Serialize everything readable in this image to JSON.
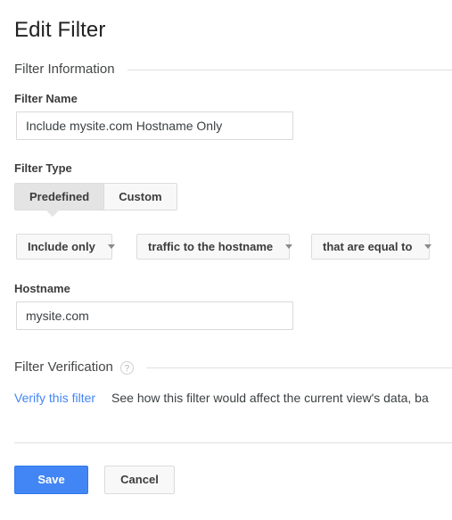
{
  "page": {
    "title": "Edit Filter"
  },
  "sections": {
    "filter_information": {
      "label": "Filter Information"
    },
    "filter_verification": {
      "label": "Filter Verification",
      "help_icon": "help-circle-icon",
      "help_glyph": "?"
    }
  },
  "fields": {
    "filter_name": {
      "label": "Filter Name",
      "value": "Include mysite.com Hostname Only",
      "placeholder": ""
    },
    "filter_type": {
      "label": "Filter Type",
      "tabs": [
        {
          "label": "Predefined",
          "selected": true
        },
        {
          "label": "Custom",
          "selected": false
        }
      ]
    },
    "hostname": {
      "label": "Hostname",
      "value": "mysite.com",
      "placeholder": ""
    }
  },
  "dropdowns": [
    {
      "name": "action",
      "value": "Include only",
      "caret_icon": "chevron-down-icon"
    },
    {
      "name": "field",
      "value": "traffic to the hostname",
      "caret_icon": "chevron-down-icon"
    },
    {
      "name": "operator",
      "value": "that are equal to",
      "caret_icon": "chevron-down-icon"
    }
  ],
  "verification": {
    "link_label": "Verify this filter",
    "description": "See how this filter would affect the current view's data, ba"
  },
  "footer": {
    "save_label": "Save",
    "cancel_label": "Cancel"
  },
  "colors": {
    "accent_blue": "#4285f4",
    "link_blue": "#4285f4",
    "text_primary": "#3c4043",
    "border_gray": "#dcdcdc",
    "rule_gray": "#e0e0e0"
  }
}
